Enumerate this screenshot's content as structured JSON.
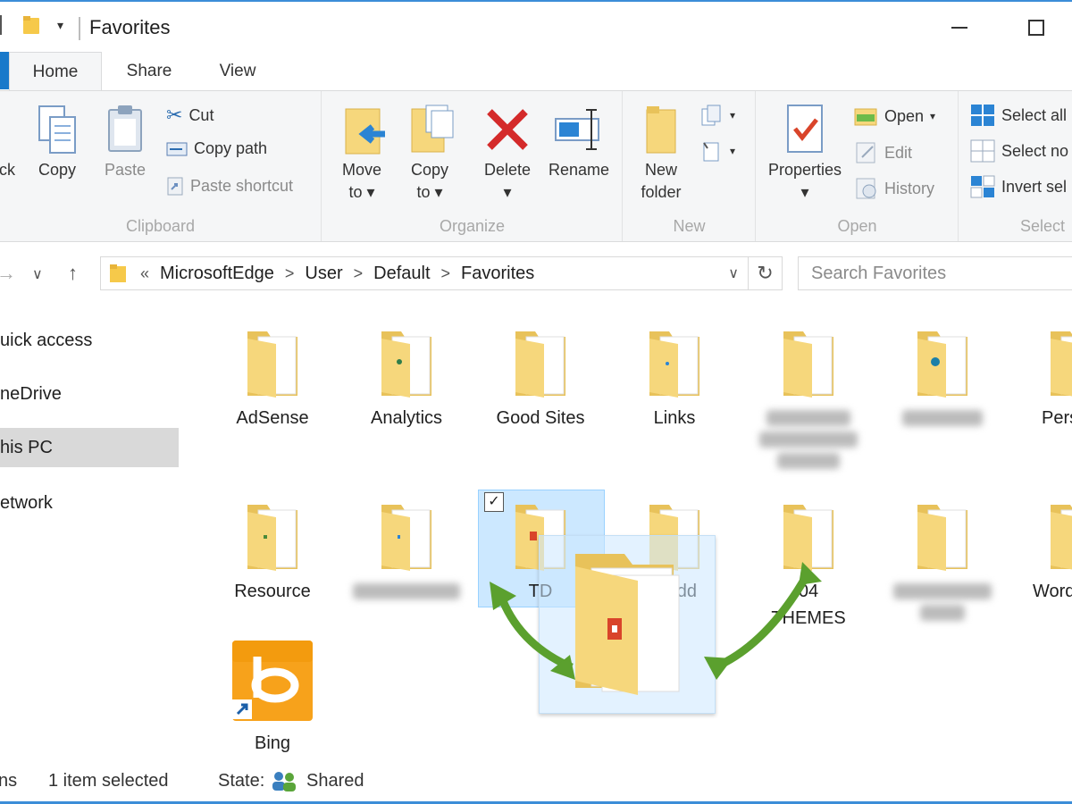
{
  "window": {
    "title": "Favorites",
    "minimize": "—",
    "maximize": "☐"
  },
  "tabs": [
    {
      "label": "Home"
    },
    {
      "label": "Share"
    },
    {
      "label": "View"
    }
  ],
  "ribbon": {
    "clipboard": {
      "label": "Clipboard",
      "pin_partial": "ick",
      "copy": "Copy",
      "paste": "Paste",
      "cut": "Cut",
      "copy_path": "Copy path",
      "paste_shortcut": "Paste shortcut"
    },
    "organize": {
      "label": "Organize",
      "move_to_1": "Move",
      "move_to_2": "to",
      "copy_to_1": "Copy",
      "copy_to_2": "to",
      "delete": "Delete",
      "rename": "Rename"
    },
    "new": {
      "label": "New",
      "new_folder_1": "New",
      "new_folder_2": "folder"
    },
    "open": {
      "label": "Open",
      "properties": "Properties",
      "open": "Open",
      "edit": "Edit",
      "history": "History"
    },
    "select": {
      "label": "Select",
      "select_all": "Select all",
      "select_none": "Select no",
      "invert": "Invert sel"
    }
  },
  "address": {
    "overflow": "«",
    "crumbs": [
      "MicrosoftEdge",
      "User",
      "Default",
      "Favorites"
    ],
    "search_placeholder": "Search Favorites"
  },
  "nav": {
    "quick_access": "uick access",
    "onedrive": "neDrive",
    "this_pc": "his PC",
    "network": "etwork"
  },
  "items": {
    "adsense": "AdSense",
    "analytics": "Analytics",
    "good_sites": "Good Sites",
    "links": "Links",
    "pers": "Pers",
    "resource": "Resource",
    "td": "TD",
    "tttddd": "tttddd",
    "themes_1": "04",
    "themes_2": "THEMES",
    "word": "Word",
    "bing": "Bing"
  },
  "status": {
    "items_partial": "ns",
    "selected": "1 item selected",
    "state_label": "State:",
    "state_value": "Shared"
  },
  "colors": {
    "accent": "#1979ca",
    "folder": "#f6d77c",
    "selection": "#cce8ff",
    "arrow": "#5ba02e",
    "bing": "#f7a21b"
  }
}
